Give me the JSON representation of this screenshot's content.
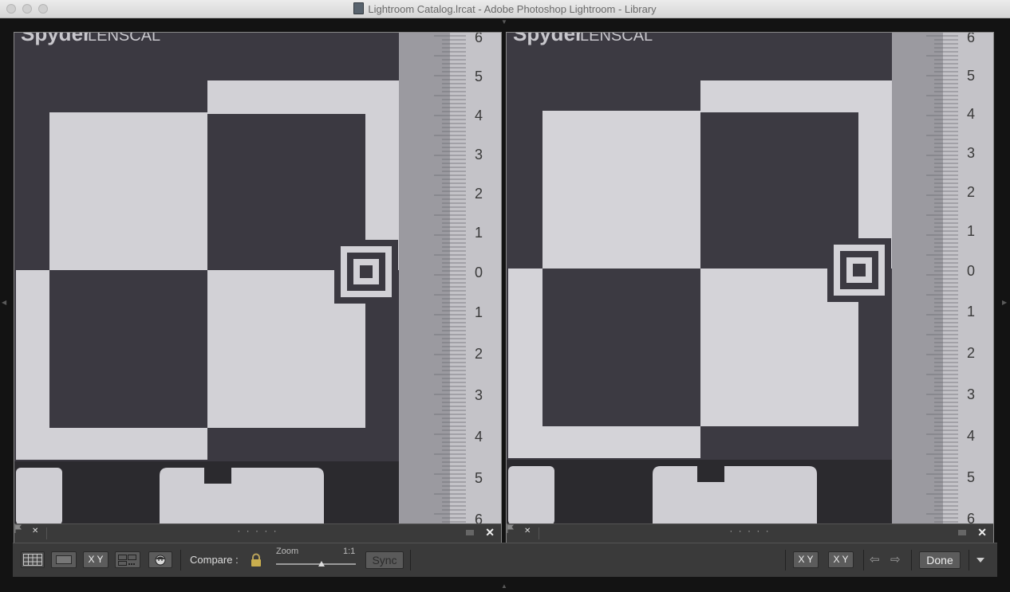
{
  "window": {
    "title": "Lightroom Catalog.lrcat - Adobe Photoshop Lightroom - Library"
  },
  "images": [
    {
      "chart_brand": "Spyder",
      "chart_model": "LENSCAL",
      "ruler_numbers": [
        "6",
        "5",
        "4",
        "3",
        "2",
        "1",
        "0",
        "1",
        "2",
        "3",
        "4",
        "5",
        "6"
      ]
    },
    {
      "chart_brand": "Spyder",
      "chart_model": "LENSCAL",
      "ruler_numbers": [
        "6",
        "5",
        "4",
        "3",
        "2",
        "1",
        "0",
        "1",
        "2",
        "3",
        "4",
        "5",
        "6"
      ]
    }
  ],
  "pane_bar": {
    "rating": "· · · · ·",
    "close": "✕"
  },
  "toolbar": {
    "xy_label": "X Y",
    "compare_label": "Compare :",
    "zoom_label": "Zoom",
    "zoom_value": "1:1",
    "zoom_level": 0.57,
    "sync_label": "Sync",
    "done_label": "Done",
    "swap_label": "X Y",
    "select_label": "X Y",
    "prev_arrow": "⇦",
    "next_arrow": "⇨"
  },
  "colors": {
    "image_dark": "#3b3941",
    "image_light": "#d2d1d6",
    "ruler": "#c4c3c8",
    "toolbar_bg": "#3a3a3a"
  }
}
